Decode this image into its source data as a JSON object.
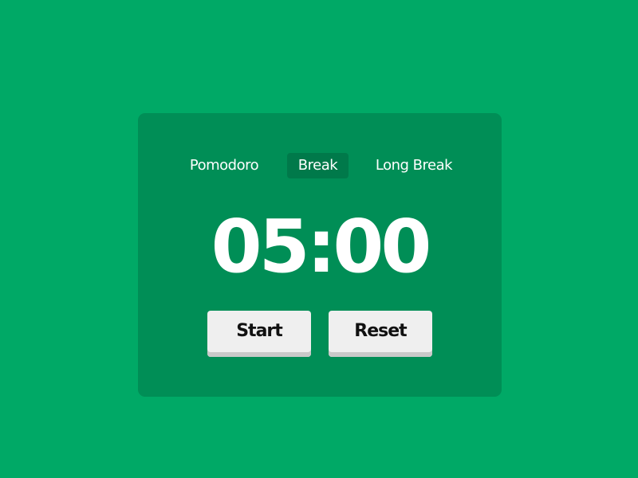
{
  "tabs": [
    {
      "label": "Pomodoro",
      "active": false
    },
    {
      "label": "Break",
      "active": true
    },
    {
      "label": "Long Break",
      "active": false
    }
  ],
  "timer": {
    "display": "05:00"
  },
  "buttons": {
    "start_label": "Start",
    "reset_label": "Reset"
  },
  "colors": {
    "background": "#00a966",
    "card": "#008e56",
    "active_tab": "#00794a",
    "button": "#efefef",
    "button_shadow": "#c9c9c9"
  }
}
